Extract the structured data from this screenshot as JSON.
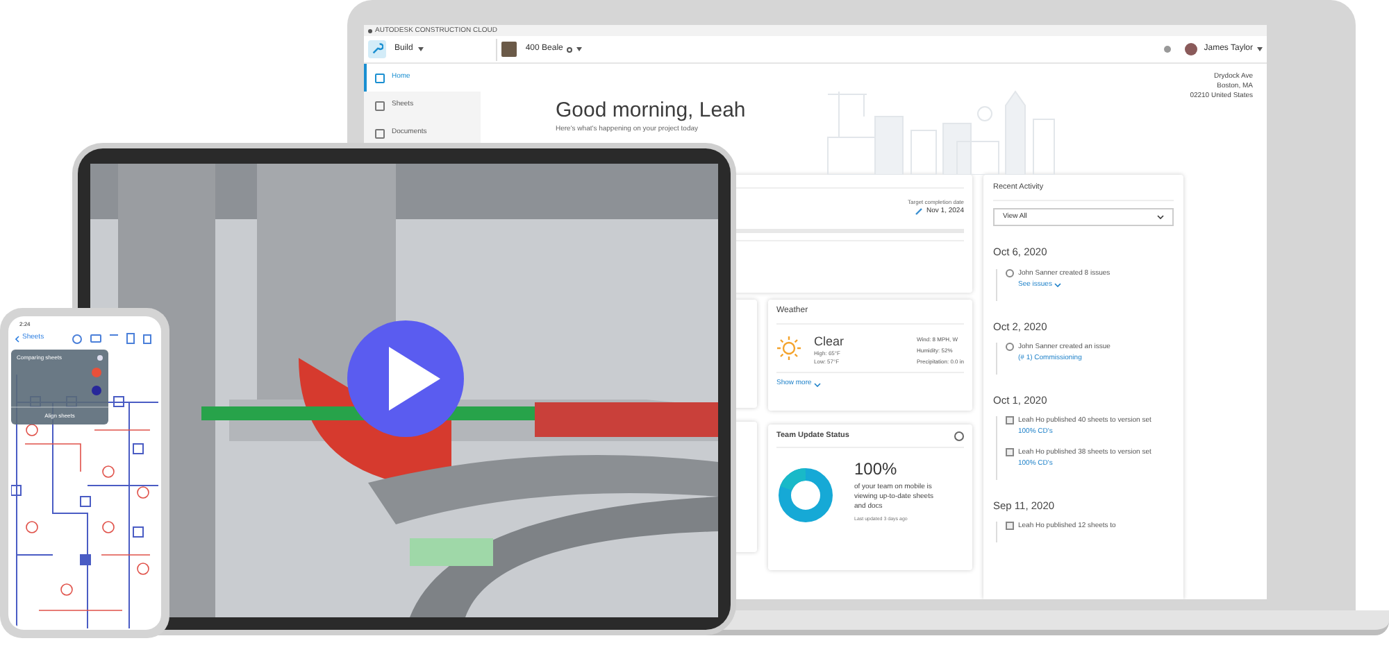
{
  "laptop": {
    "product_label": "AUTODESK CONSTRUCTION CLOUD",
    "app": "Build",
    "project": "400 Beale",
    "user": "James Taylor",
    "sidebar": {
      "items": [
        {
          "label": "Home",
          "selected": true
        },
        {
          "label": "Sheets",
          "selected": false
        },
        {
          "label": "Documents",
          "selected": false
        }
      ]
    },
    "greeting": "Good morning, Leah",
    "subtitle": "Here's what's happening on your project today",
    "address": [
      "Drydock Ave",
      "Boston, MA",
      "02210 United States"
    ],
    "schedule": {
      "label": "Target completion date",
      "date": "Nov 1, 2024"
    },
    "weather": {
      "title": "Weather",
      "condition": "Clear",
      "high": "High: 65°F",
      "low": "Low: 57°F",
      "details": [
        "Wind: 8 MPH, W",
        "Humidity: 52%",
        "Precipitation: 0.0 in"
      ],
      "show_more": "Show more"
    },
    "team_status": {
      "title": "Team Update Status",
      "percent": "100%",
      "description": "of your team on mobile is viewing up-to-date sheets and docs",
      "last_updated": "Last updated 3 days ago"
    },
    "recent_activity": {
      "title": "Recent Activity",
      "filter": "View All",
      "groups": [
        {
          "date": "Oct 6, 2020",
          "items": [
            {
              "kind": "issue",
              "text": "John Sanner created 8 issues",
              "link": "See issues",
              "expandable": true
            }
          ]
        },
        {
          "date": "Oct 2, 2020",
          "items": [
            {
              "kind": "issue",
              "text": "John Sanner created an issue",
              "link": "(# 1) Commissioning",
              "expandable": false
            }
          ]
        },
        {
          "date": "Oct 1, 2020",
          "items": [
            {
              "kind": "sheets",
              "text": "Leah Ho published 40 sheets to version set",
              "link": "100% CD's",
              "expandable": false
            },
            {
              "kind": "sheets",
              "text": "Leah Ho published 38 sheets to version set",
              "link": "100% CD's",
              "expandable": false
            }
          ]
        },
        {
          "date": "Sep 11, 2020",
          "items": [
            {
              "kind": "sheets",
              "text": "Leah Ho published 12 sheets to"
            }
          ]
        }
      ]
    }
  },
  "phone": {
    "time": "2:24",
    "back": "Sheets",
    "compare_panel": {
      "title": "Comparing sheets",
      "layers": [
        {
          "color": "#e8503a"
        },
        {
          "color": "#27279a"
        }
      ],
      "action": "Align sheets"
    }
  }
}
